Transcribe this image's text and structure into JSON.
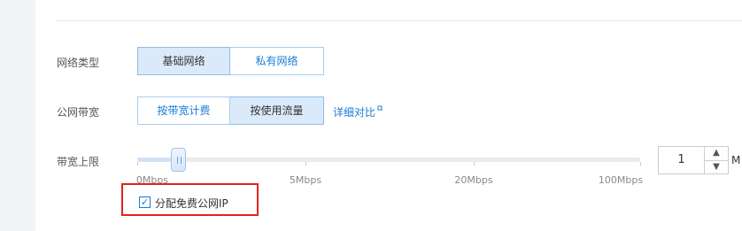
{
  "network_type": {
    "label": "网络类型",
    "options": [
      "基础网络",
      "私有网络"
    ],
    "selected": "基础网络"
  },
  "bandwidth": {
    "label": "公网带宽",
    "options": [
      "按带宽计费",
      "按使用流量"
    ],
    "selected": "按使用流量",
    "compare_link": "详细对比"
  },
  "bandwidth_limit": {
    "label": "带宽上限",
    "value": "1",
    "unit": "M",
    "slider_ticks": [
      "0Mbps",
      "5Mbps",
      "20Mbps",
      "100Mbps"
    ]
  },
  "free_ip": {
    "label": "分配免费公网IP",
    "checked": true
  },
  "colors": {
    "accent": "#1b7bd6",
    "active_bg": "#dbeafa",
    "highlight_border": "#e0251c"
  }
}
